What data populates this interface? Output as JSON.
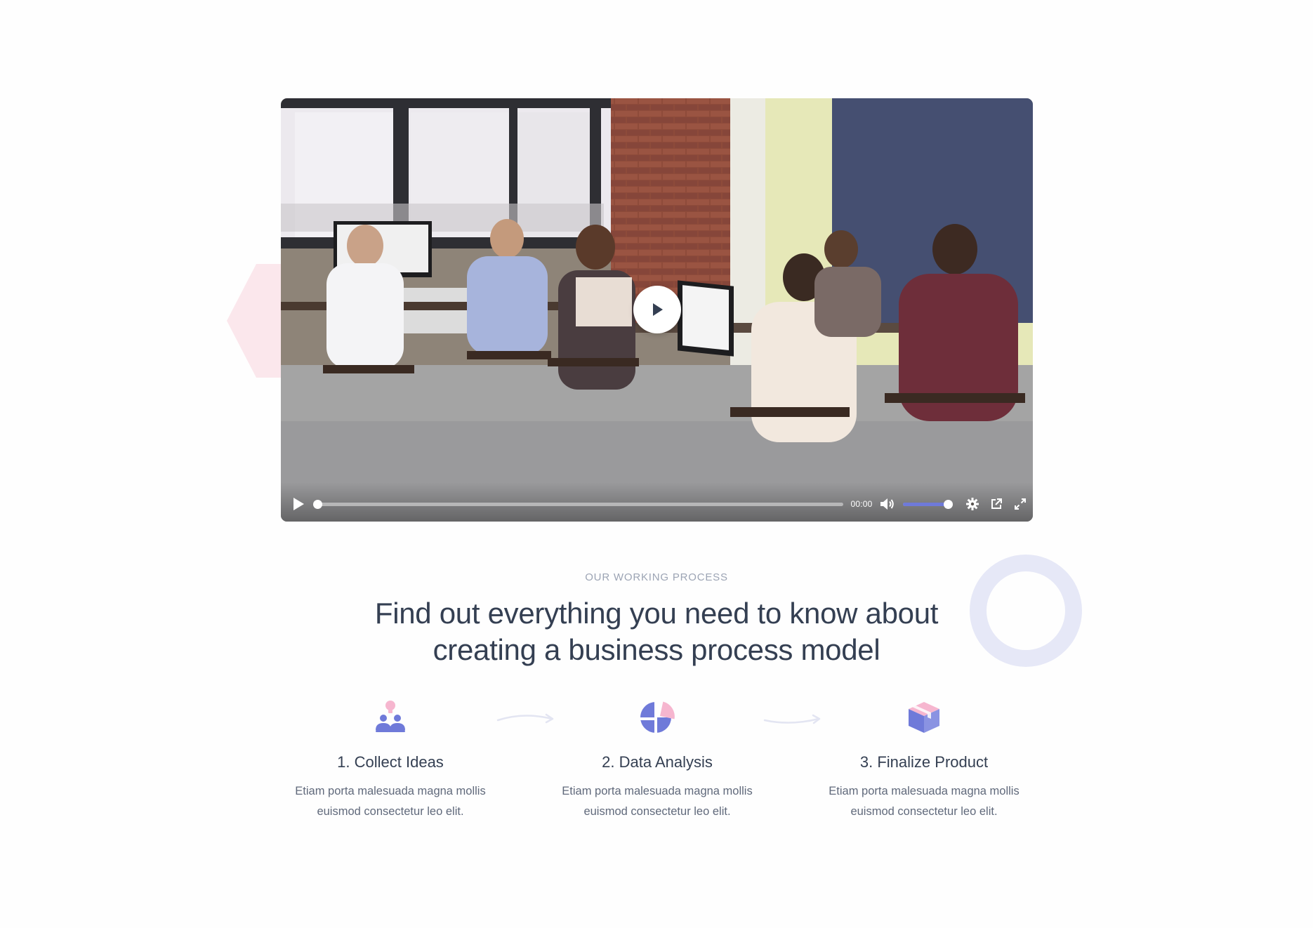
{
  "video": {
    "time": "00:00",
    "progress_fraction": 0.0,
    "volume_fraction": 1.0,
    "accent_color": "#6f7ad9"
  },
  "section": {
    "eyebrow": "OUR WORKING PROCESS",
    "headline_line1": "Find out everything you need to know about",
    "headline_line2": "creating a business process model"
  },
  "steps": [
    {
      "title": "1. Collect Ideas",
      "text_line1": "Etiam porta malesuada magna mollis",
      "text_line2": "euismod consectetur leo elit.",
      "icon": "people-idea-icon"
    },
    {
      "title": "2. Data Analysis",
      "text_line1": "Etiam porta malesuada magna mollis",
      "text_line2": "euismod consectetur leo elit.",
      "icon": "pie-chart-icon"
    },
    {
      "title": "3. Finalize Product",
      "text_line1": "Etiam porta malesuada magna mollis",
      "text_line2": "euismod consectetur leo elit.",
      "icon": "box-icon"
    }
  ],
  "colors": {
    "primary": "#6f7ad9",
    "pink": "#f6b6cf",
    "heading": "#343f52",
    "body": "#60697b",
    "muted": "#9ca4b4",
    "ring": "#e6e8f7",
    "hexagon": "#fbe7ec"
  }
}
